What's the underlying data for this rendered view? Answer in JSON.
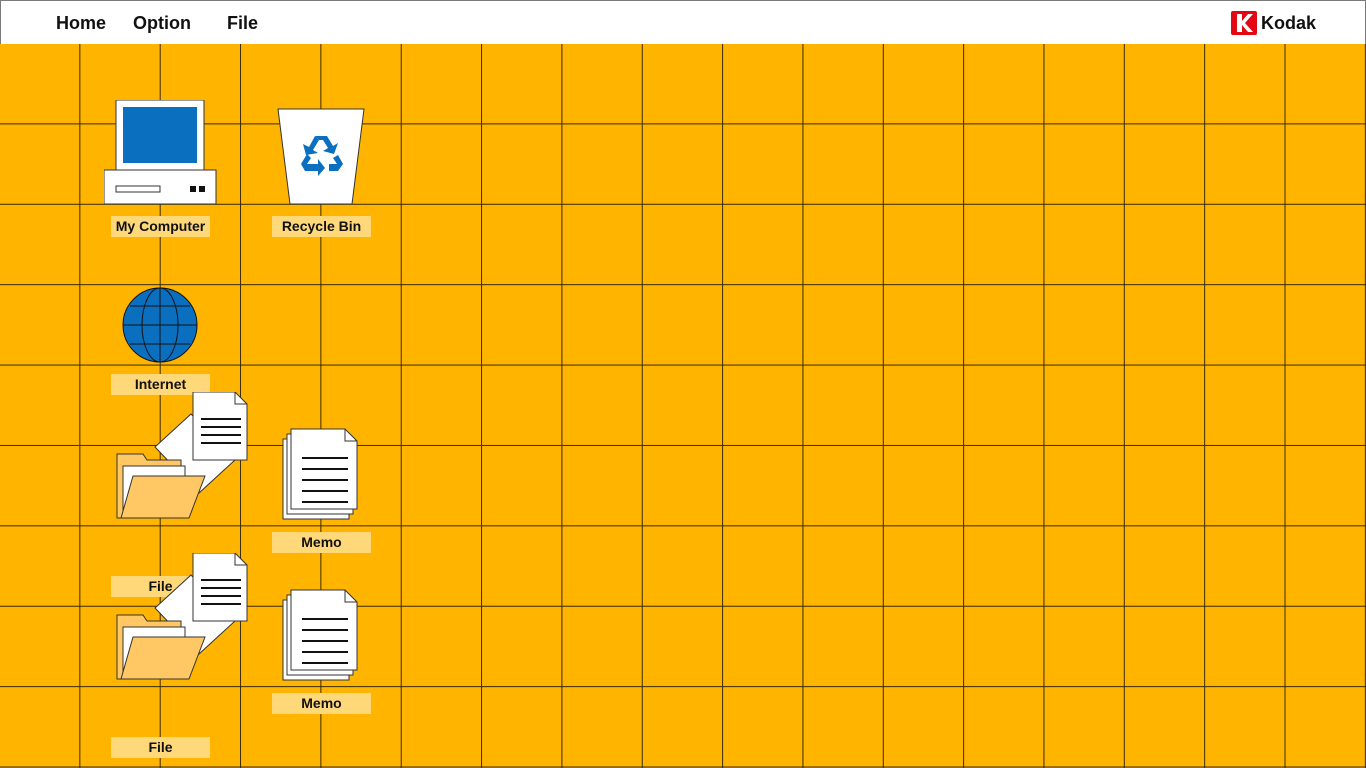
{
  "menubar": {
    "items": [
      {
        "label": "Home"
      },
      {
        "label": "Option"
      },
      {
        "label": "File"
      }
    ],
    "brand": {
      "name": "Kodak",
      "icon": "kodak-logo-icon",
      "color": "#E30613"
    }
  },
  "desktop": {
    "background": "#FFB400",
    "icons": [
      {
        "label": "My Computer",
        "icon": "computer-icon"
      },
      {
        "label": "Recycle Bin",
        "icon": "recycle-bin-icon"
      },
      {
        "label": "Internet",
        "icon": "globe-icon"
      },
      {
        "label": "File",
        "icon": "folder-documents-icon"
      },
      {
        "label": "Memo",
        "icon": "memo-documents-icon"
      },
      {
        "label": "File",
        "icon": "folder-documents-icon"
      },
      {
        "label": "Memo",
        "icon": "memo-documents-icon"
      }
    ]
  }
}
